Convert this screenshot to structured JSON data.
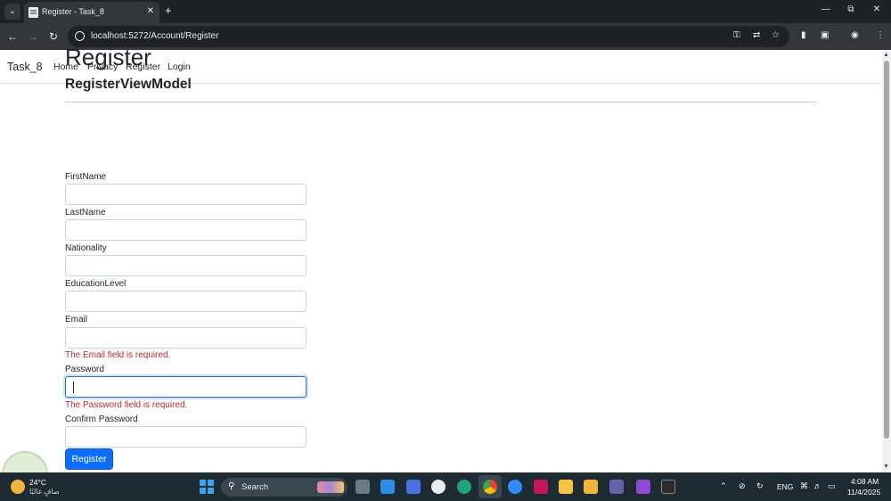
{
  "browser": {
    "tab_title": "Register - Task_8",
    "url": "localhost:5272/Account/Register",
    "icons": {
      "tab_list": "chevron-down-icon",
      "close": "close-icon",
      "new_tab": "plus-icon",
      "back": "arrow-left-icon",
      "forward": "arrow-right-icon",
      "reload": "reload-icon",
      "key": "key-icon",
      "translate": "translate-icon",
      "bookmark": "star-icon",
      "extensions": "puzzle-icon",
      "menu": "kebab-menu-icon"
    }
  },
  "navbar": {
    "brand": "Task_8",
    "links": [
      {
        "label": "Home"
      },
      {
        "label": "Privacy"
      },
      {
        "label": "Register"
      },
      {
        "label": "Login"
      }
    ]
  },
  "main": {
    "title": "Register",
    "subtitle": "RegisterViewModel",
    "fields": [
      {
        "label": "FirstName",
        "value": ""
      },
      {
        "label": "LastName",
        "value": ""
      },
      {
        "label": "Nationality",
        "value": ""
      },
      {
        "label": "EducationLevel",
        "value": ""
      },
      {
        "label": "Email",
        "value": "",
        "error": "The Email field is required."
      },
      {
        "label": "Password",
        "value": "",
        "error": "The Password field is required."
      },
      {
        "label": "Confirm Password",
        "value": ""
      }
    ],
    "submit_label": "Register",
    "accent_color": "#0d6efd",
    "error_color": "#c0282d"
  },
  "taskbar": {
    "weather_temp": "24°C",
    "weather_desc": "صافٍ غالبًا",
    "search_label": "Search",
    "language": "ENG",
    "time": "4:08 AM",
    "date": "11/4/2025"
  }
}
